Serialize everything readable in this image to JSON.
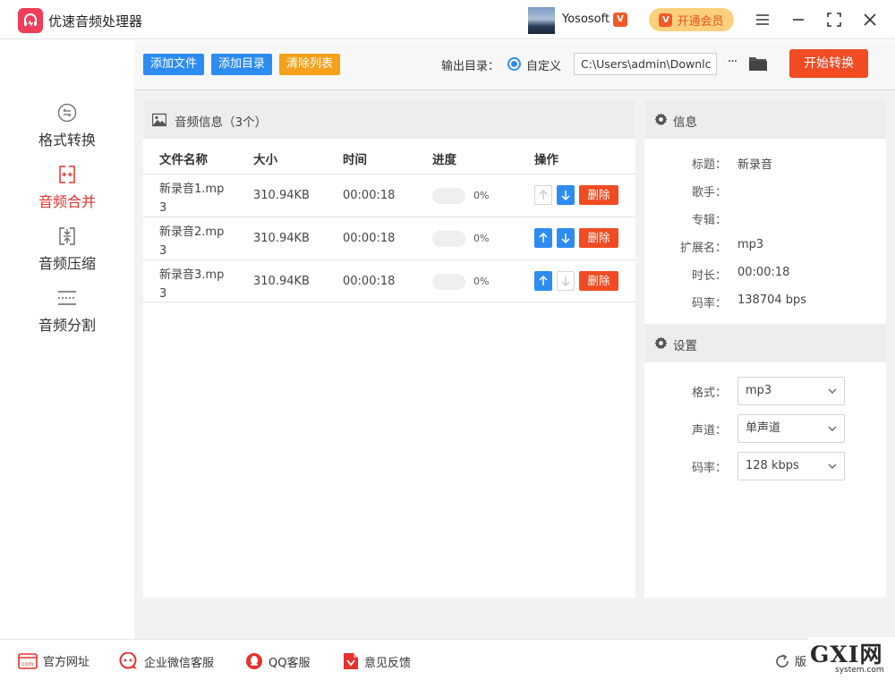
{
  "app": {
    "title": "优速音频处理器"
  },
  "user": {
    "name": "Yososoft",
    "vip_button": "开通会员"
  },
  "sidebar": {
    "items": [
      {
        "label": "格式转换",
        "icon": "format-convert-icon",
        "active": false
      },
      {
        "label": "音频合并",
        "icon": "audio-merge-icon",
        "active": true
      },
      {
        "label": "音频压缩",
        "icon": "audio-compress-icon",
        "active": false
      },
      {
        "label": "音频分割",
        "icon": "audio-split-icon",
        "active": false
      }
    ]
  },
  "toolbar": {
    "add_file": "添加文件",
    "add_dir": "添加目录",
    "clear_list": "清除列表",
    "output_label": "输出目录：",
    "radio_label": "自定义",
    "output_path": "C:\\Users\\admin\\Downlc",
    "more": "···",
    "start": "开始转换"
  },
  "audio_panel": {
    "title": "音频信息（3个）",
    "columns": [
      "文件名称",
      "大小",
      "时间",
      "进度",
      "操作"
    ],
    "delete_label": "删除",
    "rows": [
      {
        "name": "新录音1.mp3",
        "size": "310.94KB",
        "time": "00:00:18",
        "progress": 0,
        "progress_text": "0%",
        "up_enabled": false,
        "down_enabled": true
      },
      {
        "name": "新录音2.mp3",
        "size": "310.94KB",
        "time": "00:00:18",
        "progress": 0,
        "progress_text": "0%",
        "up_enabled": true,
        "down_enabled": true
      },
      {
        "name": "新录音3.mp3",
        "size": "310.94KB",
        "time": "00:00:18",
        "progress": 0,
        "progress_text": "0%",
        "up_enabled": true,
        "down_enabled": false
      }
    ]
  },
  "info_panel": {
    "title": "信息",
    "fields": [
      {
        "label": "标题：",
        "value": "新录音"
      },
      {
        "label": "歌手：",
        "value": ""
      },
      {
        "label": "专辑：",
        "value": ""
      },
      {
        "label": "扩展名：",
        "value": "mp3"
      },
      {
        "label": "时长：",
        "value": "00:00:18"
      },
      {
        "label": "码率：",
        "value": "138704 bps"
      }
    ]
  },
  "settings_panel": {
    "title": "设置",
    "fields": [
      {
        "label": "格式：",
        "value": "mp3"
      },
      {
        "label": "声道：",
        "value": "单声道"
      },
      {
        "label": "码率：",
        "value": "128 kbps"
      }
    ]
  },
  "footer": {
    "links": [
      "官方网址",
      "企业微信客服",
      "QQ客服",
      "意见反馈"
    ],
    "version": "版"
  },
  "watermark": {
    "main": "GXI网",
    "sub": "system.com"
  },
  "colors": {
    "accent_blue": "#2d8cf0",
    "accent_orange": "#f5a11c",
    "accent_red": "#f04b22",
    "nav_active": "#e5322d",
    "vip_bg": "#fcd07c"
  }
}
